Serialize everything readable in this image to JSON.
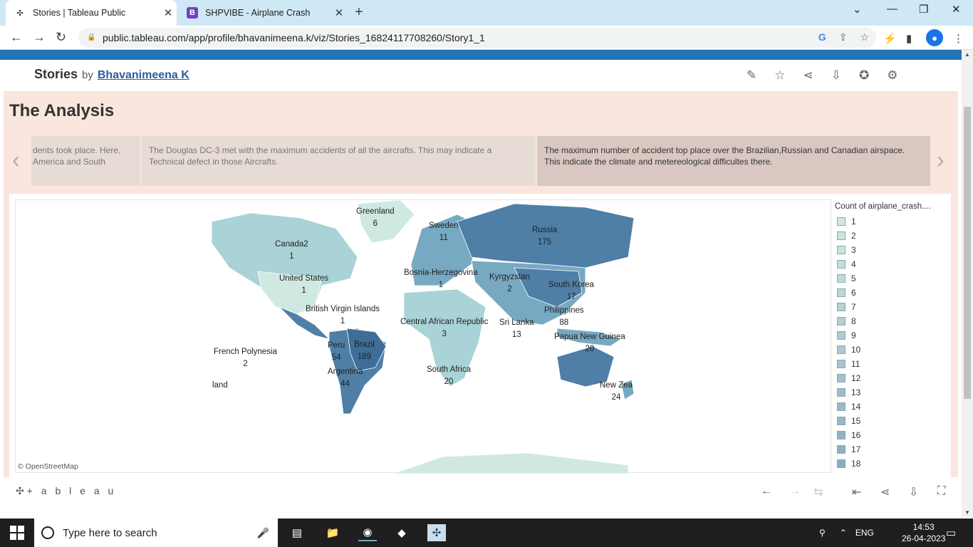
{
  "browser": {
    "tabs": [
      {
        "title": "Stories | Tableau Public",
        "active": true
      },
      {
        "title": "SHPVIBE - Airplane Crash",
        "active": false
      }
    ],
    "url": "public.tableau.com/app/profile/bhavanimeena.k/viz/Stories_16824117708260/Story1_1"
  },
  "header": {
    "title": "Stories",
    "by": "by",
    "author": "Bhavanimeena K"
  },
  "story": {
    "title": "The Analysis",
    "points": [
      "dents took place. Here, America and South",
      "The Douglas DC-3 met with the maximum accidents of all the aircrafts. This may indicate a Technical defect in those Aircrafts.",
      "The maximum number of accident  top place over the Brazilian,Russian and Canadian airspace. This indicate the climate and metereological difficultes there."
    ]
  },
  "map": {
    "attribution": "© OpenStreetMap",
    "labels": [
      {
        "name": "Greenland",
        "value": "6"
      },
      {
        "name": "Sweden",
        "value": "11"
      },
      {
        "name": "Russia",
        "value": "175"
      },
      {
        "name": "Canada2",
        "value": "1"
      },
      {
        "name": "United States",
        "value": "1"
      },
      {
        "name": "Bosnia-Herzegovina",
        "value": "1"
      },
      {
        "name": "Kyrgyzstan",
        "value": "2"
      },
      {
        "name": "South Korea",
        "value": "17"
      },
      {
        "name": "British Virgin Islands",
        "value": "1"
      },
      {
        "name": "Philippines",
        "value": "88"
      },
      {
        "name": "Central African Republic",
        "value": "3"
      },
      {
        "name": "Sri Lanka",
        "value": "13"
      },
      {
        "name": "Papua New Guinea",
        "value": "20"
      },
      {
        "name": "Peru",
        "value": "54"
      },
      {
        "name": "Brazil",
        "value": "189"
      },
      {
        "name": "French Polynesia",
        "value": "2"
      },
      {
        "name": "South Africa",
        "value": "20"
      },
      {
        "name": "Argentina",
        "value": "44"
      },
      {
        "name": "New Zea",
        "value": "24"
      },
      {
        "name": "land",
        "value": ""
      }
    ]
  },
  "legend": {
    "title": "Count of airplane_crash....",
    "items": [
      "1",
      "2",
      "3",
      "4",
      "5",
      "6",
      "7",
      "8",
      "9",
      "10",
      "11",
      "12",
      "13",
      "14",
      "15",
      "16",
      "17",
      "18"
    ],
    "color_low": "#cfe9e2",
    "color_high": "#4f7ea6"
  },
  "footer": {
    "logo": "+ a b l e a u"
  },
  "taskbar": {
    "search_placeholder": "Type here to search",
    "lang": "ENG",
    "time": "14:53",
    "date": "26-04-2023"
  }
}
